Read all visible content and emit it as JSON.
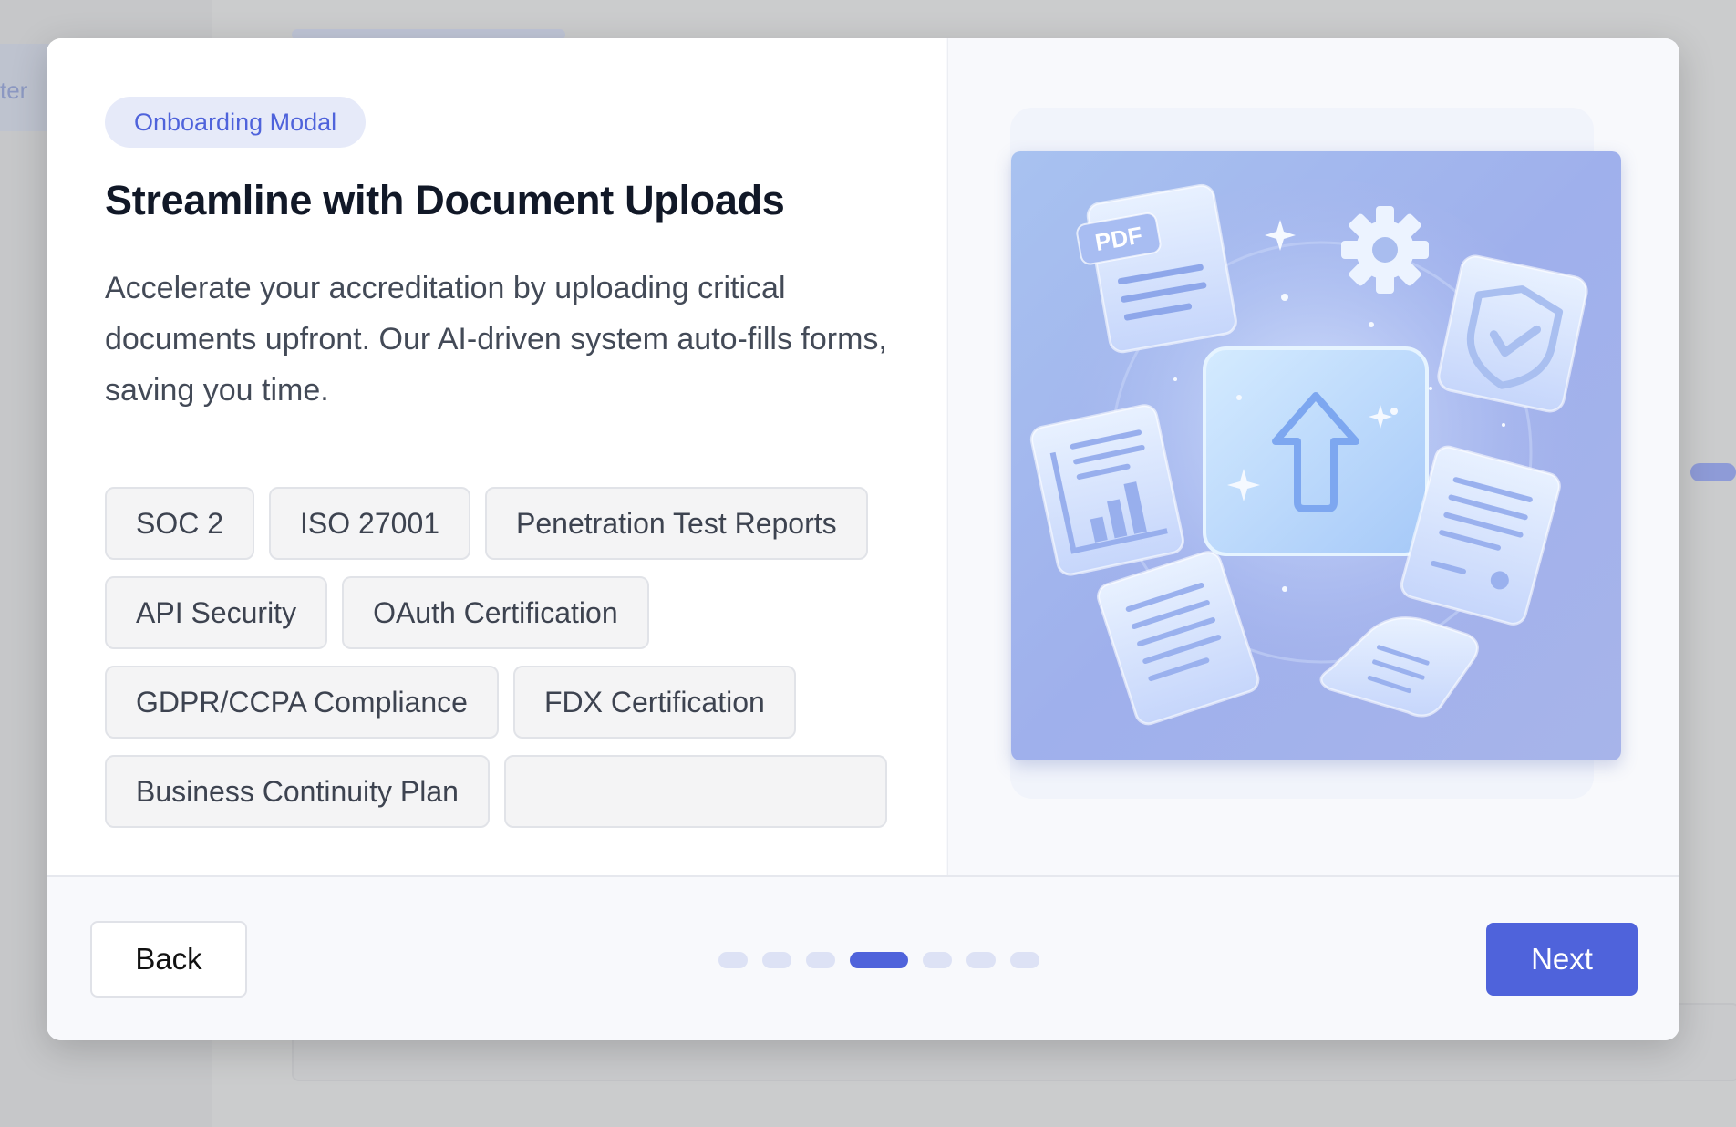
{
  "background": {
    "sidebar_fragment": "ter"
  },
  "modal": {
    "badge": "Onboarding Modal",
    "title": "Streamline with Document Uploads",
    "description": "Accelerate your accreditation by uploading critical documents upfront. Our AI-driven system auto-fills forms, saving you time.",
    "tags": [
      "SOC 2",
      "ISO 27001",
      "Penetration Test Reports",
      "API Security",
      "OAuth Certification",
      "GDPR/CCPA Compliance",
      "FDX Certification",
      "Business Continuity Plan"
    ],
    "illustration": {
      "pdf_label": "PDF",
      "icons": [
        "upload-icon",
        "pdf-document-icon",
        "gear-icon",
        "shield-check-icon",
        "chart-document-icon",
        "certificate-document-icon",
        "text-document-icon",
        "scroll-icon"
      ]
    }
  },
  "footer": {
    "back_label": "Back",
    "next_label": "Next",
    "steps_total": 7,
    "current_step": 4
  },
  "colors": {
    "accent": "#4f63db",
    "badge_bg": "#e6eaf9",
    "dot_inactive": "#dde2f5"
  }
}
